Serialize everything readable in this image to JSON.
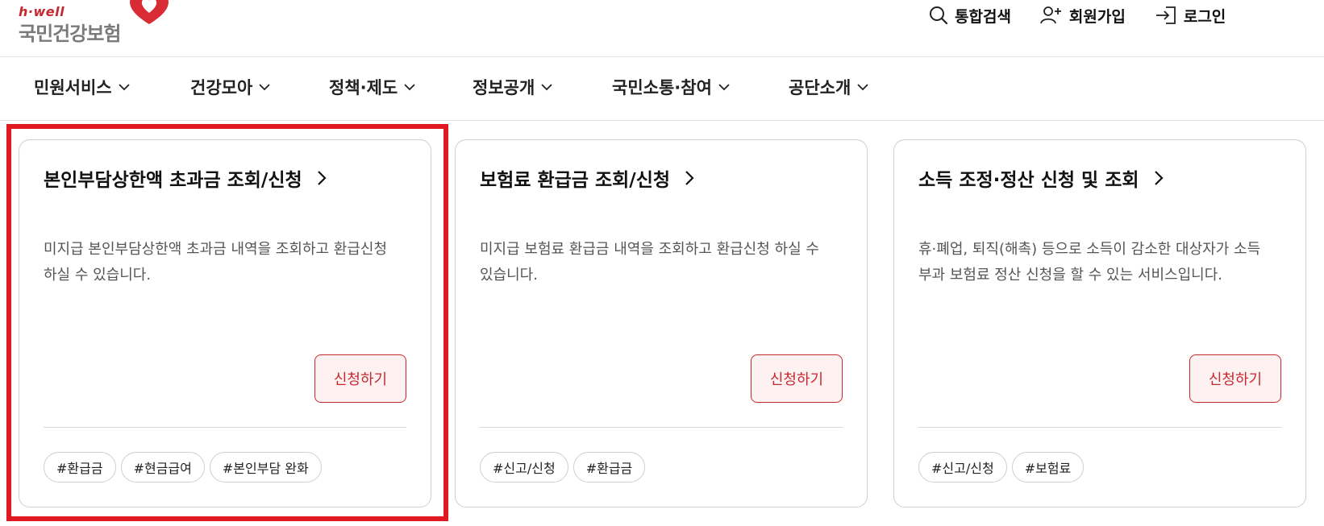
{
  "header": {
    "logo_top": "h·well",
    "logo_main": "국민건강보험",
    "util": [
      {
        "label": "통합검색",
        "icon": "search-icon"
      },
      {
        "label": "회원가입",
        "icon": "user-add-icon"
      },
      {
        "label": "로그인",
        "icon": "login-icon"
      }
    ]
  },
  "nav": {
    "items": [
      {
        "label": "민원서비스"
      },
      {
        "label": "건강모아"
      },
      {
        "label": "정책·제도"
      },
      {
        "label": "정보공개"
      },
      {
        "label": "국민소통·참여"
      },
      {
        "label": "공단소개"
      }
    ]
  },
  "cards": [
    {
      "title": "본인부담상한액 초과금 조회/신청",
      "desc": "미지급 본인부담상한액 초과금 내역을 조회하고 환급신청 하실 수 있습니다.",
      "button": "신청하기",
      "tags": [
        "#환급금",
        "#현금급여",
        "#본인부담 완화"
      ]
    },
    {
      "title": "보험료 환급금 조회/신청",
      "desc": "미지급 보험료 환급금 내역을 조회하고 환급신청 하실 수 있습니다.",
      "button": "신청하기",
      "tags": [
        "#신고/신청",
        "#환급금"
      ]
    },
    {
      "title": "소득 조정·정산 신청 및 조회",
      "desc": "휴·폐업, 퇴직(해촉) 등으로 소득이 감소한 대상자가 소득 부과 보험료 정산 신청을 할 수 있는 서비스입니다.",
      "button": "신청하기",
      "tags": [
        "#신고/신청",
        "#보험료"
      ]
    }
  ],
  "colors": {
    "brand_red": "#c7272f",
    "highlight_red": "#e0181f",
    "button_bg": "#fdf1f1"
  }
}
